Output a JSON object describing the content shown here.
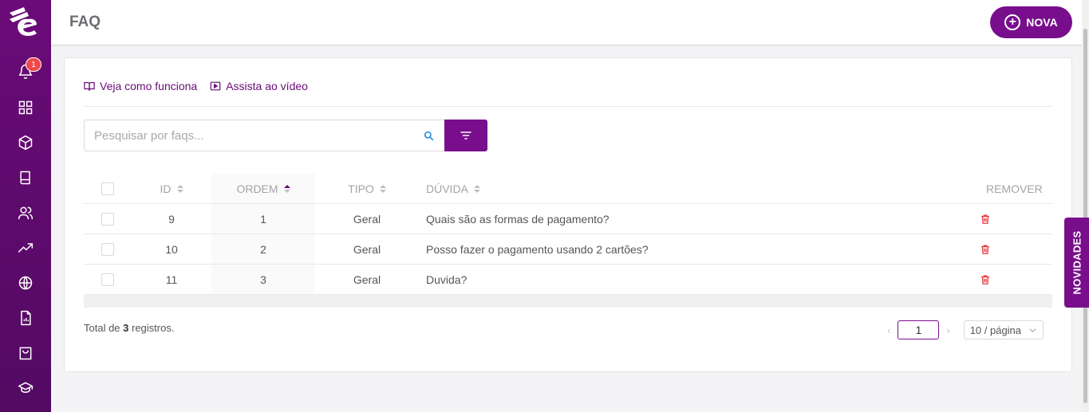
{
  "header": {
    "title": "FAQ",
    "new_button_label": "NOVA"
  },
  "sidebar": {
    "notification_count": "1",
    "items": [
      {
        "icon": "bell-icon"
      },
      {
        "icon": "grid-icon"
      },
      {
        "icon": "box-icon"
      },
      {
        "icon": "book-icon"
      },
      {
        "icon": "users-icon"
      },
      {
        "icon": "trending-icon"
      },
      {
        "icon": "globe-icon"
      },
      {
        "icon": "report-icon"
      },
      {
        "icon": "shopping-bag-icon"
      },
      {
        "icon": "graduation-cap-icon"
      }
    ]
  },
  "help": {
    "how_it_works": "Veja como funciona",
    "watch_video": "Assista ao vídeo"
  },
  "search": {
    "placeholder": "Pesquisar por faqs..."
  },
  "table": {
    "columns": {
      "id": "ID",
      "ordem": "ORDEM",
      "tipo": "TIPO",
      "duvida": "DÚVIDA",
      "remover": "REMOVER"
    },
    "sorted_column": "ORDEM",
    "rows": [
      {
        "id": "9",
        "ordem": "1",
        "tipo": "Geral",
        "duvida": "Quais são as formas de pagamento?"
      },
      {
        "id": "10",
        "ordem": "2",
        "tipo": "Geral",
        "duvida": "Posso fazer o pagamento usando 2 cartões?"
      },
      {
        "id": "11",
        "ordem": "3",
        "tipo": "Geral",
        "duvida": "Duvida?"
      }
    ]
  },
  "footer": {
    "total_prefix": "Total de ",
    "total_count": "3",
    "total_suffix": " registros."
  },
  "pagination": {
    "current_page": "1",
    "page_size": "10 / página"
  },
  "novidades_tab": "NOVIDADES",
  "colors": {
    "brand": "#780e8c",
    "sidebar": "#5e0a6f",
    "delete": "#e5393b"
  }
}
